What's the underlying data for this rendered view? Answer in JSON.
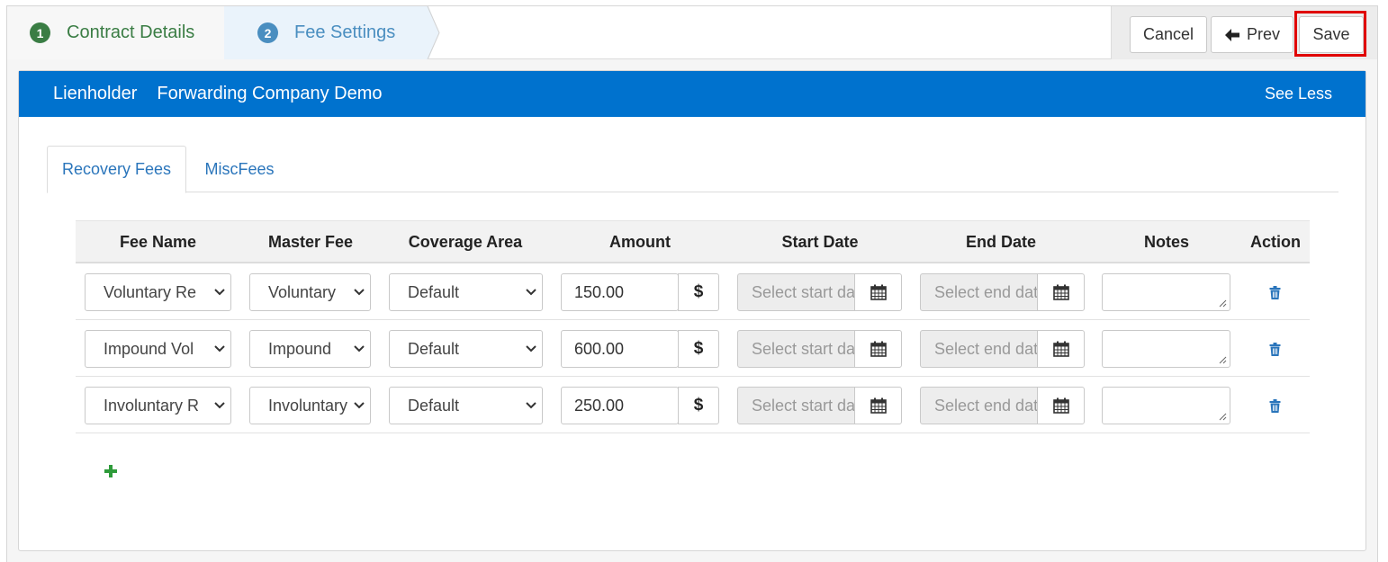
{
  "wizard": {
    "steps": [
      {
        "number": "1",
        "label": "Contract Details"
      },
      {
        "number": "2",
        "label": "Fee Settings"
      }
    ],
    "buttons": {
      "cancel": "Cancel",
      "prev": "Prev",
      "save": "Save"
    }
  },
  "panel": {
    "label": "Lienholder",
    "company": "Forwarding Company Demo",
    "toggle": "See Less"
  },
  "tabs": [
    {
      "label": "Recovery Fees",
      "active": true
    },
    {
      "label": "MiscFees",
      "active": false
    }
  ],
  "table": {
    "headers": [
      "Fee Name",
      "Master Fee",
      "Coverage Area",
      "Amount",
      "Start Date",
      "End Date",
      "Notes",
      "Action"
    ],
    "currency_symbol": "$",
    "start_placeholder": "Select start date",
    "end_placeholder": "Select end date",
    "rows": [
      {
        "fee_name": "Voluntary Re",
        "master_fee": "Voluntary",
        "coverage_area": "Default",
        "amount": "150.00",
        "notes": ""
      },
      {
        "fee_name": "Impound Vol",
        "master_fee": "Impound",
        "coverage_area": "Default",
        "amount": "600.00",
        "notes": ""
      },
      {
        "fee_name": "Involuntary R",
        "master_fee": "Involuntary",
        "coverage_area": "Default",
        "amount": "250.00",
        "notes": ""
      }
    ]
  },
  "colors": {
    "header_blue": "#0072ce",
    "step_done_green": "#3a7d44",
    "step_active_blue": "#4a8ec0",
    "link_blue": "#2a75bb",
    "add_green": "#2e9b3a",
    "highlight_red": "#e00000"
  },
  "icons": {
    "prev": "arrow-left-icon",
    "caret": "chevron-down-icon",
    "calendar": "calendar-icon",
    "delete": "trash-icon",
    "add": "plus-icon"
  }
}
